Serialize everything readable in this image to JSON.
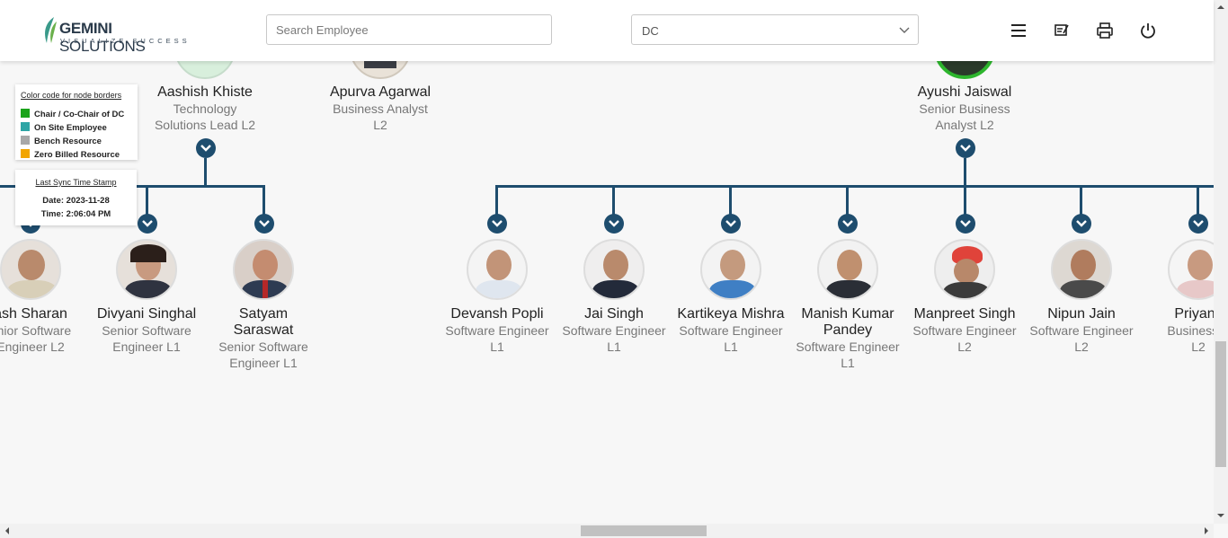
{
  "header": {
    "logo_text_bold": "GEMINI",
    "logo_text_regular": " SOLUTIONS",
    "logo_tagline": "VISUALIZE SUCCESS",
    "search_placeholder": "Search Employee",
    "dept_select_value": "DC",
    "icons": [
      "menu-icon",
      "notes-icon",
      "print-icon",
      "power-icon"
    ]
  },
  "legend": {
    "title": "Color code for node borders",
    "items": [
      {
        "label": "Chair / Co-Chair of DC",
        "color": "#1aa31a"
      },
      {
        "label": "On Site Employee",
        "color": "#2ea5a5"
      },
      {
        "label": "Bench Resource",
        "color": "#a8a8a8"
      },
      {
        "label": "Zero Billed Resource",
        "color": "#f2a500"
      }
    ]
  },
  "sync": {
    "title": "Last Sync Time Stamp",
    "date": "Date: 2023-11-28",
    "time": "Time: 2:06:04 PM"
  },
  "top_nodes": [
    {
      "name": "Aashish Khiste",
      "role_line1": "Technology",
      "role_line2": "Solutions Lead L2"
    },
    {
      "name": "Apurva Agarwal",
      "role_line1": "Business Analyst",
      "role_line2": "L2"
    },
    {
      "name": "Ayushi Jaiswal",
      "role_line1": "Senior Business",
      "role_line2": "Analyst L2"
    }
  ],
  "child_nodes": [
    {
      "name": "ash Sharan",
      "role_line1": "enior Software",
      "role_line2": "Engineer L2"
    },
    {
      "name": "Divyani Singhal",
      "role_line1": "Senior Software",
      "role_line2": "Engineer L1"
    },
    {
      "name_line1": "Satyam",
      "name_line2": "Saraswat",
      "role_line1": "Senior Software",
      "role_line2": "Engineer L1"
    },
    {
      "name": "Devansh Popli",
      "role_line1": "Software Engineer",
      "role_line2": "L1"
    },
    {
      "name": "Jai Singh",
      "role_line1": "Software Engineer",
      "role_line2": "L1"
    },
    {
      "name": "Kartikeya Mishra",
      "role_line1": "Software Engineer",
      "role_line2": "L1"
    },
    {
      "name_line1": "Manish Kumar",
      "name_line2": "Pandey",
      "role_line1": "Software Engineer",
      "role_line2": "L1"
    },
    {
      "name": "Manpreet Singh",
      "role_line1": "Software Engineer",
      "role_line2": "L2"
    },
    {
      "name": "Nipun Jain",
      "role_line1": "Software Engineer",
      "role_line2": "L2"
    },
    {
      "name": "Priyank",
      "role_line1": "Business A",
      "role_line2": "L2"
    }
  ],
  "colors": {
    "connector": "#1e4d6e",
    "chair_border": "#1aa31a"
  }
}
